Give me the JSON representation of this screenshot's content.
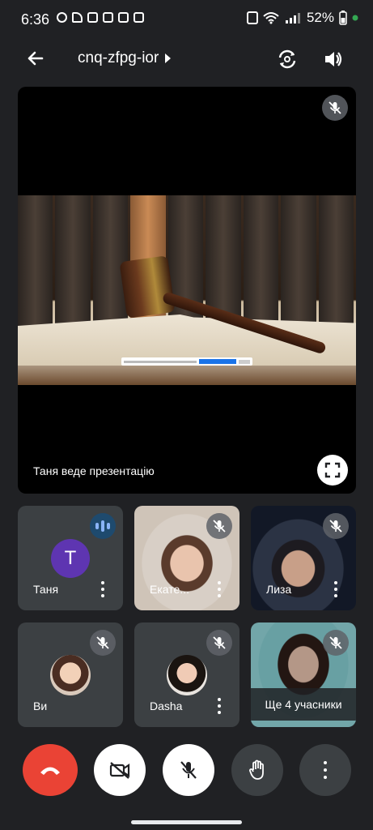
{
  "status_bar": {
    "time": "6:36",
    "battery": "52%"
  },
  "header": {
    "meeting_code": "cnq-zfpg-ior"
  },
  "presentation": {
    "label": "Таня веде презентацію"
  },
  "participants": [
    {
      "name": "Таня",
      "initial": "T",
      "speaking": true
    },
    {
      "name": "Екате..."
    },
    {
      "name": "Лиза"
    },
    {
      "name": "Ви"
    },
    {
      "name": "Dasha"
    }
  ],
  "overflow_tile": {
    "label": "Ще 4 учасники"
  },
  "colors": {
    "background": "#202124",
    "tile": "#3c4043",
    "end_call": "#ea4335",
    "avatar_t": "#5e35b1"
  }
}
